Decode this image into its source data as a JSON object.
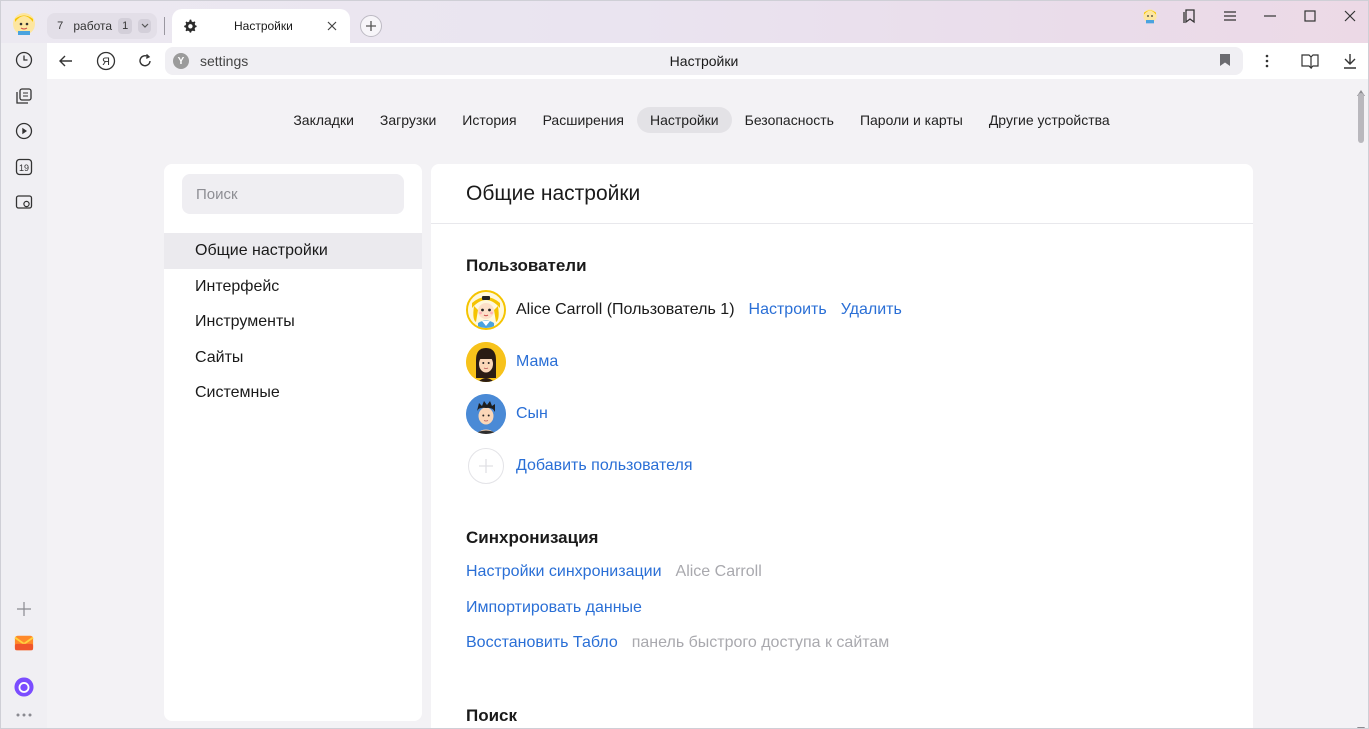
{
  "browser": {
    "tab_group": {
      "count": "7",
      "name": "работа",
      "count2": "1"
    },
    "active_tab": {
      "title": "Настройки"
    },
    "address": {
      "url": "settings",
      "title": "Настройки",
      "shield_letter": "Y"
    },
    "left_nav_back": "Я"
  },
  "sidebar_icons": [
    "history-icon",
    "collections-icon",
    "video-icon",
    "calendar-icon",
    "screenshot-icon",
    "add-icon",
    "mail-icon",
    "alice-icon",
    "more-icon"
  ],
  "calendar_day": "19",
  "topnav": {
    "items": [
      {
        "label": "Закладки"
      },
      {
        "label": "Загрузки"
      },
      {
        "label": "История"
      },
      {
        "label": "Расширения"
      },
      {
        "label": "Настройки"
      },
      {
        "label": "Безопасность"
      },
      {
        "label": "Пароли и карты"
      },
      {
        "label": "Другие устройства"
      }
    ]
  },
  "left": {
    "search_placeholder": "Поиск",
    "items": [
      {
        "label": "Общие настройки"
      },
      {
        "label": "Интерфейс"
      },
      {
        "label": "Инструменты"
      },
      {
        "label": "Сайты"
      },
      {
        "label": "Системные"
      }
    ]
  },
  "main": {
    "title": "Общие настройки",
    "users": {
      "heading": "Пользователи",
      "current": {
        "name": "Alice Carroll (Пользователь 1)",
        "configure": "Настроить",
        "delete": "Удалить"
      },
      "others": [
        {
          "name": "Мама"
        },
        {
          "name": "Сын"
        }
      ],
      "add": "Добавить пользователя"
    },
    "sync": {
      "heading": "Синхронизация",
      "settings_link": "Настройки синхронизации",
      "settings_note": "Alice Carroll",
      "import_link": "Импортировать данные",
      "restore_link": "Восстановить Табло",
      "restore_note": "панель быстрого доступа к сайтам"
    },
    "search": {
      "heading": "Поиск"
    }
  },
  "colors": {
    "link": "#2a6fd6",
    "muted": "#a9a9ae",
    "accent_alice": "#7b4dff",
    "mail": "#ff6b35"
  }
}
